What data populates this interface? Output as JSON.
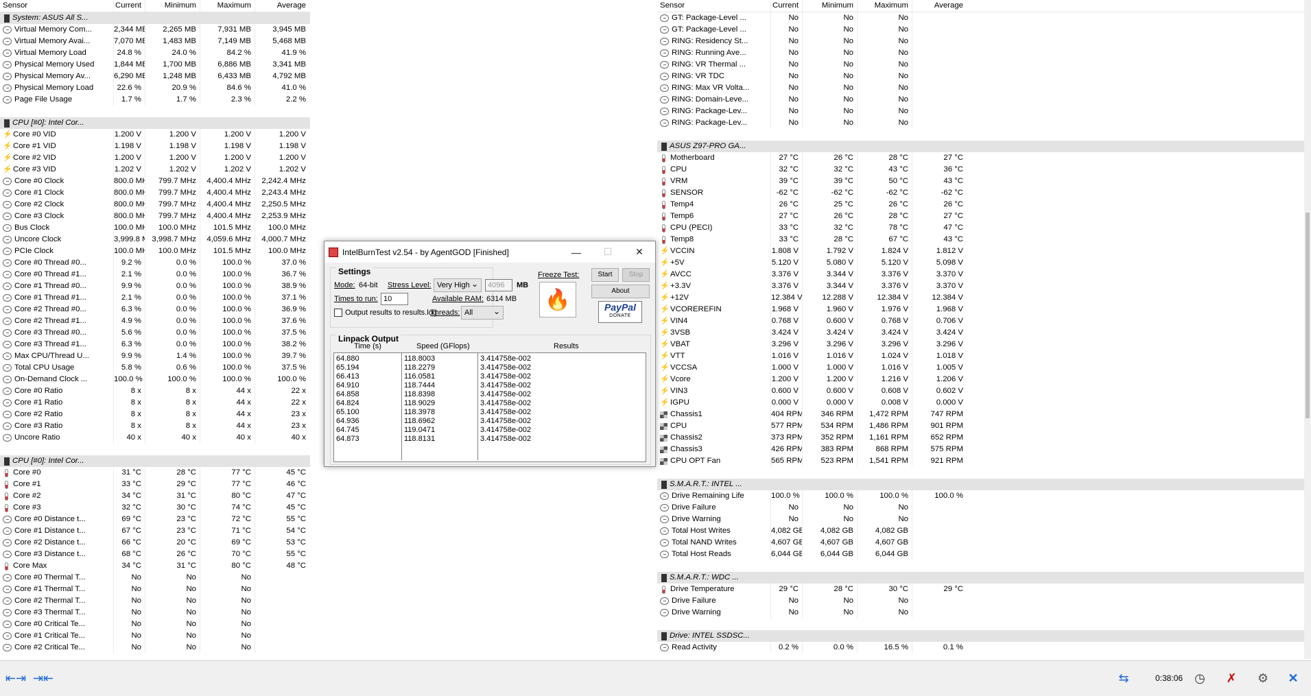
{
  "columns": [
    "Sensor",
    "Current",
    "Minimum",
    "Maximum",
    "Average"
  ],
  "left_panel": [
    {
      "type": "group",
      "label": "System: ASUS All S..."
    },
    {
      "type": "row",
      "icon": "clock",
      "label": "Virtual Memory Com...",
      "cur": "2,344 MB",
      "min": "2,265 MB",
      "max": "7,931 MB",
      "avg": "3,945 MB"
    },
    {
      "type": "row",
      "icon": "clock",
      "label": "Virtual Memory Avai...",
      "cur": "7,070 MB",
      "min": "1,483 MB",
      "max": "7,149 MB",
      "avg": "5,468 MB"
    },
    {
      "type": "row",
      "icon": "clock",
      "label": "Virtual Memory Load",
      "cur": "24.8 %",
      "min": "24.0 %",
      "max": "84.2 %",
      "avg": "41.9 %"
    },
    {
      "type": "row",
      "icon": "clock",
      "label": "Physical Memory Used",
      "cur": "1,844 MB",
      "min": "1,700 MB",
      "max": "6,886 MB",
      "avg": "3,341 MB"
    },
    {
      "type": "row",
      "icon": "clock",
      "label": "Physical Memory Av...",
      "cur": "6,290 MB",
      "min": "1,248 MB",
      "max": "6,433 MB",
      "avg": "4,792 MB"
    },
    {
      "type": "row",
      "icon": "clock",
      "label": "Physical Memory Load",
      "cur": "22.6 %",
      "min": "20.9 %",
      "max": "84.6 %",
      "avg": "41.0 %"
    },
    {
      "type": "row",
      "icon": "clock",
      "label": "Page File Usage",
      "cur": "1.7 %",
      "min": "1.7 %",
      "max": "2.3 %",
      "avg": "2.2 %"
    },
    {
      "type": "blank"
    },
    {
      "type": "group",
      "label": "CPU [#0]: Intel Cor..."
    },
    {
      "type": "row",
      "icon": "volt",
      "label": "Core #0 VID",
      "cur": "1.200 V",
      "min": "1.200 V",
      "max": "1.200 V",
      "avg": "1.200 V"
    },
    {
      "type": "row",
      "icon": "volt",
      "label": "Core #1 VID",
      "cur": "1.198 V",
      "min": "1.198 V",
      "max": "1.198 V",
      "avg": "1.198 V"
    },
    {
      "type": "row",
      "icon": "volt",
      "label": "Core #2 VID",
      "cur": "1.200 V",
      "min": "1.200 V",
      "max": "1.200 V",
      "avg": "1.200 V"
    },
    {
      "type": "row",
      "icon": "volt",
      "label": "Core #3 VID",
      "cur": "1.202 V",
      "min": "1.202 V",
      "max": "1.202 V",
      "avg": "1.202 V"
    },
    {
      "type": "row",
      "icon": "clock",
      "label": "Core #0 Clock",
      "cur": "800.0 MHz",
      "min": "799.7 MHz",
      "max": "4,400.4 MHz",
      "avg": "2,242.4 MHz"
    },
    {
      "type": "row",
      "icon": "clock",
      "label": "Core #1 Clock",
      "cur": "800.0 MHz",
      "min": "799.7 MHz",
      "max": "4,400.4 MHz",
      "avg": "2,243.4 MHz"
    },
    {
      "type": "row",
      "icon": "clock",
      "label": "Core #2 Clock",
      "cur": "800.0 MHz",
      "min": "799.7 MHz",
      "max": "4,400.4 MHz",
      "avg": "2,250.5 MHz"
    },
    {
      "type": "row",
      "icon": "clock",
      "label": "Core #3 Clock",
      "cur": "800.0 MHz",
      "min": "799.7 MHz",
      "max": "4,400.4 MHz",
      "avg": "2,253.9 MHz"
    },
    {
      "type": "row",
      "icon": "clock",
      "label": "Bus Clock",
      "cur": "100.0 MHz",
      "min": "100.0 MHz",
      "max": "101.5 MHz",
      "avg": "100.0 MHz"
    },
    {
      "type": "row",
      "icon": "clock",
      "label": "Uncore Clock",
      "cur": "3,999.8 MHz",
      "min": "3,998.7 MHz",
      "max": "4,059.6 MHz",
      "avg": "4,000.7 MHz"
    },
    {
      "type": "row",
      "icon": "clock",
      "label": "PCIe Clock",
      "cur": "100.0 MHz",
      "min": "100.0 MHz",
      "max": "101.5 MHz",
      "avg": "100.0 MHz"
    },
    {
      "type": "row",
      "icon": "clock",
      "label": "Core #0 Thread #0...",
      "cur": "9.2 %",
      "min": "0.0 %",
      "max": "100.0 %",
      "avg": "37.0 %"
    },
    {
      "type": "row",
      "icon": "clock",
      "label": "Core #0 Thread #1...",
      "cur": "2.1 %",
      "min": "0.0 %",
      "max": "100.0 %",
      "avg": "36.7 %"
    },
    {
      "type": "row",
      "icon": "clock",
      "label": "Core #1 Thread #0...",
      "cur": "9.9 %",
      "min": "0.0 %",
      "max": "100.0 %",
      "avg": "38.9 %"
    },
    {
      "type": "row",
      "icon": "clock",
      "label": "Core #1 Thread #1...",
      "cur": "2.1 %",
      "min": "0.0 %",
      "max": "100.0 %",
      "avg": "37.1 %"
    },
    {
      "type": "row",
      "icon": "clock",
      "label": "Core #2 Thread #0...",
      "cur": "6.3 %",
      "min": "0.0 %",
      "max": "100.0 %",
      "avg": "36.9 %"
    },
    {
      "type": "row",
      "icon": "clock",
      "label": "Core #2 Thread #1...",
      "cur": "4.9 %",
      "min": "0.0 %",
      "max": "100.0 %",
      "avg": "37.6 %"
    },
    {
      "type": "row",
      "icon": "clock",
      "label": "Core #3 Thread #0...",
      "cur": "5.6 %",
      "min": "0.0 %",
      "max": "100.0 %",
      "avg": "37.5 %"
    },
    {
      "type": "row",
      "icon": "clock",
      "label": "Core #3 Thread #1...",
      "cur": "6.3 %",
      "min": "0.0 %",
      "max": "100.0 %",
      "avg": "38.2 %"
    },
    {
      "type": "row",
      "icon": "clock",
      "label": "Max CPU/Thread U...",
      "cur": "9.9 %",
      "min": "1.4 %",
      "max": "100.0 %",
      "avg": "39.7 %"
    },
    {
      "type": "row",
      "icon": "clock",
      "label": "Total CPU Usage",
      "cur": "5.8 %",
      "min": "0.6 %",
      "max": "100.0 %",
      "avg": "37.5 %"
    },
    {
      "type": "row",
      "icon": "clock",
      "label": "On-Demand Clock ...",
      "cur": "100.0 %",
      "min": "100.0 %",
      "max": "100.0 %",
      "avg": "100.0 %"
    },
    {
      "type": "row",
      "icon": "clock",
      "label": "Core #0 Ratio",
      "cur": "8 x",
      "min": "8 x",
      "max": "44 x",
      "avg": "22 x"
    },
    {
      "type": "row",
      "icon": "clock",
      "label": "Core #1 Ratio",
      "cur": "8 x",
      "min": "8 x",
      "max": "44 x",
      "avg": "22 x"
    },
    {
      "type": "row",
      "icon": "clock",
      "label": "Core #2 Ratio",
      "cur": "8 x",
      "min": "8 x",
      "max": "44 x",
      "avg": "23 x"
    },
    {
      "type": "row",
      "icon": "clock",
      "label": "Core #3 Ratio",
      "cur": "8 x",
      "min": "8 x",
      "max": "44 x",
      "avg": "23 x"
    },
    {
      "type": "row",
      "icon": "clock",
      "label": "Uncore Ratio",
      "cur": "40 x",
      "min": "40 x",
      "max": "40 x",
      "avg": "40 x"
    },
    {
      "type": "blank"
    },
    {
      "type": "group",
      "label": "CPU [#0]: Intel Cor..."
    },
    {
      "type": "row",
      "icon": "temp",
      "label": "Core #0",
      "cur": "31 °C",
      "min": "28 °C",
      "max": "77 °C",
      "avg": "45 °C"
    },
    {
      "type": "row",
      "icon": "temp",
      "label": "Core #1",
      "cur": "33 °C",
      "min": "29 °C",
      "max": "77 °C",
      "avg": "46 °C"
    },
    {
      "type": "row",
      "icon": "temp",
      "label": "Core #2",
      "cur": "34 °C",
      "min": "31 °C",
      "max": "80 °C",
      "avg": "47 °C"
    },
    {
      "type": "row",
      "icon": "temp",
      "label": "Core #3",
      "cur": "32 °C",
      "min": "30 °C",
      "max": "74 °C",
      "avg": "45 °C"
    },
    {
      "type": "row",
      "icon": "clock",
      "label": "Core #0 Distance t...",
      "cur": "69 °C",
      "min": "23 °C",
      "max": "72 °C",
      "avg": "55 °C"
    },
    {
      "type": "row",
      "icon": "clock",
      "label": "Core #1 Distance t...",
      "cur": "67 °C",
      "min": "23 °C",
      "max": "71 °C",
      "avg": "54 °C"
    },
    {
      "type": "row",
      "icon": "clock",
      "label": "Core #2 Distance t...",
      "cur": "66 °C",
      "min": "20 °C",
      "max": "69 °C",
      "avg": "53 °C"
    },
    {
      "type": "row",
      "icon": "clock",
      "label": "Core #3 Distance t...",
      "cur": "68 °C",
      "min": "26 °C",
      "max": "70 °C",
      "avg": "55 °C"
    },
    {
      "type": "row",
      "icon": "temp",
      "label": "Core Max",
      "cur": "34 °C",
      "min": "31 °C",
      "max": "80 °C",
      "avg": "48 °C"
    },
    {
      "type": "row",
      "icon": "clock",
      "label": "Core #0 Thermal T...",
      "cur": "No",
      "min": "No",
      "max": "No",
      "avg": ""
    },
    {
      "type": "row",
      "icon": "clock",
      "label": "Core #1 Thermal T...",
      "cur": "No",
      "min": "No",
      "max": "No",
      "avg": ""
    },
    {
      "type": "row",
      "icon": "clock",
      "label": "Core #2 Thermal T...",
      "cur": "No",
      "min": "No",
      "max": "No",
      "avg": ""
    },
    {
      "type": "row",
      "icon": "clock",
      "label": "Core #3 Thermal T...",
      "cur": "No",
      "min": "No",
      "max": "No",
      "avg": ""
    },
    {
      "type": "row",
      "icon": "clock",
      "label": "Core #0 Critical Te...",
      "cur": "No",
      "min": "No",
      "max": "No",
      "avg": ""
    },
    {
      "type": "row",
      "icon": "clock",
      "label": "Core #1 Critical Te...",
      "cur": "No",
      "min": "No",
      "max": "No",
      "avg": ""
    },
    {
      "type": "row",
      "icon": "clock",
      "label": "Core #2 Critical Te...",
      "cur": "No",
      "min": "No",
      "max": "No",
      "avg": ""
    }
  ],
  "right_panel": [
    {
      "type": "row",
      "icon": "clock",
      "label": "GT: Package-Level ...",
      "cur": "No",
      "min": "No",
      "max": "No",
      "avg": ""
    },
    {
      "type": "row",
      "icon": "clock",
      "label": "GT: Package-Level ...",
      "cur": "No",
      "min": "No",
      "max": "No",
      "avg": ""
    },
    {
      "type": "row",
      "icon": "clock",
      "label": "RING: Residency St...",
      "cur": "No",
      "min": "No",
      "max": "No",
      "avg": ""
    },
    {
      "type": "row",
      "icon": "clock",
      "label": "RING: Running Ave...",
      "cur": "No",
      "min": "No",
      "max": "No",
      "avg": ""
    },
    {
      "type": "row",
      "icon": "clock",
      "label": "RING: VR Thermal ...",
      "cur": "No",
      "min": "No",
      "max": "No",
      "avg": ""
    },
    {
      "type": "row",
      "icon": "clock",
      "label": "RING: VR TDC",
      "cur": "No",
      "min": "No",
      "max": "No",
      "avg": ""
    },
    {
      "type": "row",
      "icon": "clock",
      "label": "RING: Max VR Volta...",
      "cur": "No",
      "min": "No",
      "max": "No",
      "avg": ""
    },
    {
      "type": "row",
      "icon": "clock",
      "label": "RING: Domain-Leve...",
      "cur": "No",
      "min": "No",
      "max": "No",
      "avg": ""
    },
    {
      "type": "row",
      "icon": "clock",
      "label": "RING: Package-Lev...",
      "cur": "No",
      "min": "No",
      "max": "No",
      "avg": ""
    },
    {
      "type": "row",
      "icon": "clock",
      "label": "RING: Package-Lev...",
      "cur": "No",
      "min": "No",
      "max": "No",
      "avg": ""
    },
    {
      "type": "blank"
    },
    {
      "type": "group",
      "label": "ASUS Z97-PRO GA..."
    },
    {
      "type": "row",
      "icon": "temp",
      "label": "Motherboard",
      "cur": "27 °C",
      "min": "26 °C",
      "max": "28 °C",
      "avg": "27 °C"
    },
    {
      "type": "row",
      "icon": "temp",
      "label": "CPU",
      "cur": "32 °C",
      "min": "32 °C",
      "max": "43 °C",
      "avg": "36 °C"
    },
    {
      "type": "row",
      "icon": "temp",
      "label": "VRM",
      "cur": "39 °C",
      "min": "39 °C",
      "max": "50 °C",
      "avg": "43 °C"
    },
    {
      "type": "row",
      "icon": "temp",
      "label": "SENSOR",
      "cur": "-62 °C",
      "min": "-62 °C",
      "max": "-62 °C",
      "avg": "-62 °C"
    },
    {
      "type": "row",
      "icon": "temp",
      "label": "Temp4",
      "cur": "26 °C",
      "min": "25 °C",
      "max": "26 °C",
      "avg": "26 °C"
    },
    {
      "type": "row",
      "icon": "temp",
      "label": "Temp6",
      "cur": "27 °C",
      "min": "26 °C",
      "max": "28 °C",
      "avg": "27 °C"
    },
    {
      "type": "row",
      "icon": "temp",
      "label": "CPU (PECI)",
      "cur": "33 °C",
      "min": "32 °C",
      "max": "78 °C",
      "avg": "47 °C"
    },
    {
      "type": "row",
      "icon": "temp",
      "label": "Temp8",
      "cur": "33 °C",
      "min": "28 °C",
      "max": "67 °C",
      "avg": "43 °C"
    },
    {
      "type": "row",
      "icon": "volt",
      "label": "VCCIN",
      "cur": "1.808 V",
      "min": "1.792 V",
      "max": "1.824 V",
      "avg": "1.812 V"
    },
    {
      "type": "row",
      "icon": "volt",
      "label": "+5V",
      "cur": "5.120 V",
      "min": "5.080 V",
      "max": "5.120 V",
      "avg": "5.098 V"
    },
    {
      "type": "row",
      "icon": "volt",
      "label": "AVCC",
      "cur": "3.376 V",
      "min": "3.344 V",
      "max": "3.376 V",
      "avg": "3.370 V"
    },
    {
      "type": "row",
      "icon": "volt",
      "label": "+3.3V",
      "cur": "3.376 V",
      "min": "3.344 V",
      "max": "3.376 V",
      "avg": "3.370 V"
    },
    {
      "type": "row",
      "icon": "volt",
      "label": "+12V",
      "cur": "12.384 V",
      "min": "12.288 V",
      "max": "12.384 V",
      "avg": "12.384 V"
    },
    {
      "type": "row",
      "icon": "volt",
      "label": "VCOREREFIN",
      "cur": "1.968 V",
      "min": "1.960 V",
      "max": "1.976 V",
      "avg": "1.968 V"
    },
    {
      "type": "row",
      "icon": "volt",
      "label": "VIN4",
      "cur": "0.768 V",
      "min": "0.600 V",
      "max": "0.768 V",
      "avg": "0.706 V"
    },
    {
      "type": "row",
      "icon": "volt",
      "label": "3VSB",
      "cur": "3.424 V",
      "min": "3.424 V",
      "max": "3.424 V",
      "avg": "3.424 V"
    },
    {
      "type": "row",
      "icon": "volt",
      "label": "VBAT",
      "cur": "3.296 V",
      "min": "3.296 V",
      "max": "3.296 V",
      "avg": "3.296 V"
    },
    {
      "type": "row",
      "icon": "volt",
      "label": "VTT",
      "cur": "1.016 V",
      "min": "1.016 V",
      "max": "1.024 V",
      "avg": "1.018 V"
    },
    {
      "type": "row",
      "icon": "volt",
      "label": "VCCSA",
      "cur": "1.000 V",
      "min": "1.000 V",
      "max": "1.016 V",
      "avg": "1.005 V"
    },
    {
      "type": "row",
      "icon": "volt",
      "label": "Vcore",
      "cur": "1.200 V",
      "min": "1.200 V",
      "max": "1.216 V",
      "avg": "1.206 V"
    },
    {
      "type": "row",
      "icon": "volt",
      "label": "VIN3",
      "cur": "0.600 V",
      "min": "0.600 V",
      "max": "0.608 V",
      "avg": "0.602 V"
    },
    {
      "type": "row",
      "icon": "volt",
      "label": "IGPU",
      "cur": "0.000 V",
      "min": "0.000 V",
      "max": "0.008 V",
      "avg": "0.000 V"
    },
    {
      "type": "row",
      "icon": "fan",
      "label": "Chassis1",
      "cur": "404 RPM",
      "min": "346 RPM",
      "max": "1,472 RPM",
      "avg": "747 RPM"
    },
    {
      "type": "row",
      "icon": "fan",
      "label": "CPU",
      "cur": "577 RPM",
      "min": "534 RPM",
      "max": "1,486 RPM",
      "avg": "901 RPM"
    },
    {
      "type": "row",
      "icon": "fan",
      "label": "Chassis2",
      "cur": "373 RPM",
      "min": "352 RPM",
      "max": "1,161 RPM",
      "avg": "652 RPM"
    },
    {
      "type": "row",
      "icon": "fan",
      "label": "Chassis3",
      "cur": "426 RPM",
      "min": "383 RPM",
      "max": "868 RPM",
      "avg": "575 RPM"
    },
    {
      "type": "row",
      "icon": "fan",
      "label": "CPU OPT Fan",
      "cur": "565 RPM",
      "min": "523 RPM",
      "max": "1,541 RPM",
      "avg": "921 RPM"
    },
    {
      "type": "blank"
    },
    {
      "type": "group",
      "label": "S.M.A.R.T.: INTEL ..."
    },
    {
      "type": "row",
      "icon": "clock",
      "label": "Drive Remaining Life",
      "cur": "100.0 %",
      "min": "100.0 %",
      "max": "100.0 %",
      "avg": "100.0 %"
    },
    {
      "type": "row",
      "icon": "clock",
      "label": "Drive Failure",
      "cur": "No",
      "min": "No",
      "max": "No",
      "avg": ""
    },
    {
      "type": "row",
      "icon": "clock",
      "label": "Drive Warning",
      "cur": "No",
      "min": "No",
      "max": "No",
      "avg": ""
    },
    {
      "type": "row",
      "icon": "clock",
      "label": "Total Host Writes",
      "cur": "4,082 GB",
      "min": "4,082 GB",
      "max": "4,082 GB",
      "avg": ""
    },
    {
      "type": "row",
      "icon": "clock",
      "label": "Total NAND Writes",
      "cur": "4,607 GB",
      "min": "4,607 GB",
      "max": "4,607 GB",
      "avg": ""
    },
    {
      "type": "row",
      "icon": "clock",
      "label": "Total Host Reads",
      "cur": "6,044 GB",
      "min": "6,044 GB",
      "max": "6,044 GB",
      "avg": ""
    },
    {
      "type": "blank"
    },
    {
      "type": "group",
      "label": "S.M.A.R.T.: WDC ..."
    },
    {
      "type": "row",
      "icon": "temp",
      "label": "Drive Temperature",
      "cur": "29 °C",
      "min": "28 °C",
      "max": "30 °C",
      "avg": "29 °C"
    },
    {
      "type": "row",
      "icon": "clock",
      "label": "Drive Failure",
      "cur": "No",
      "min": "No",
      "max": "No",
      "avg": ""
    },
    {
      "type": "row",
      "icon": "clock",
      "label": "Drive Warning",
      "cur": "No",
      "min": "No",
      "max": "No",
      "avg": ""
    },
    {
      "type": "blank"
    },
    {
      "type": "group",
      "label": "Drive: INTEL SSDSC..."
    },
    {
      "type": "row",
      "icon": "clock",
      "label": "Read Activity",
      "cur": "0.2 %",
      "min": "0.0 %",
      "max": "16.5 %",
      "avg": "0.1 %"
    }
  ],
  "dialog": {
    "title": "IntelBurnTest v2.54 - by AgentGOD [Finished]",
    "settings_label": "Settings",
    "mode_label": "Mode:",
    "mode_value": "64-bit",
    "stress_label": "Stress Level:",
    "stress_value": "Very High",
    "mem_value": "4096",
    "mem_unit": "MB",
    "times_label": "Times to run:",
    "times_value": "10",
    "avail_label": "Available RAM:",
    "avail_value": "6314 MB",
    "output_label": "Output results to results.log",
    "threads_label": "Threads:",
    "threads_value": "All",
    "freeze_label": "Freeze Test:",
    "start_label": "Start",
    "stop_label": "Stop",
    "about_label": "About",
    "paypal_label": "PayPal",
    "donate_label": "DONATE",
    "linpack_label": "Linpack Output",
    "col_time": "Time (s)",
    "col_speed": "Speed (GFlops)",
    "col_results": "Results",
    "times": "64.880\n65.194\n66.413\n64.910\n64.858\n64.824\n65.100\n64.936\n64.745\n64.873",
    "speeds": "118.8003\n118.2279\n116.0581\n118.7444\n118.8398\n118.9029\n118.3978\n118.6962\n119.0471\n118.8131",
    "results": "3.414758e-002\n3.414758e-002\n3.414758e-002\n3.414758e-002\n3.414758e-002\n3.414758e-002\n3.414758e-002\n3.414758e-002\n3.414758e-002\n3.414758e-002"
  },
  "taskbar": {
    "elapsed": "0:38:06"
  }
}
